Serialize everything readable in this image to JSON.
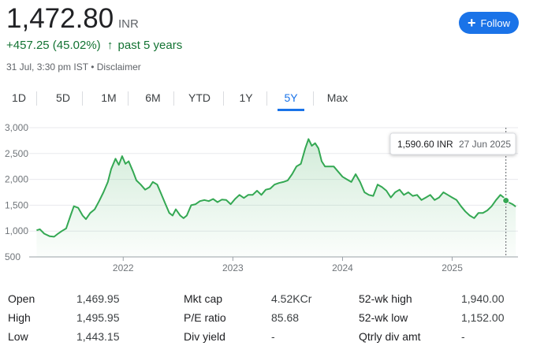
{
  "quote": {
    "price": "1,472.80",
    "currency": "INR",
    "change": "+457.25 (45.02%)",
    "change_arrow": "↑",
    "period": "past 5 years",
    "timestamp": "31 Jul, 3:30 pm IST",
    "separator": "•",
    "disclaimer": "Disclaimer",
    "follow_label": "Follow"
  },
  "tabs": [
    {
      "label": "1D",
      "active": false
    },
    {
      "label": "5D",
      "active": false
    },
    {
      "label": "1M",
      "active": false
    },
    {
      "label": "6M",
      "active": false
    },
    {
      "label": "YTD",
      "active": false
    },
    {
      "label": "1Y",
      "active": false
    },
    {
      "label": "5Y",
      "active": true
    },
    {
      "label": "Max",
      "active": false
    }
  ],
  "tooltip": {
    "value": "1,590.60 INR",
    "date": "27 Jun 2025"
  },
  "stats": [
    [
      {
        "label": "Open",
        "value": "1,469.95"
      },
      {
        "label": "Mkt cap",
        "value": "4.52KCr"
      },
      {
        "label": "52-wk high",
        "value": "1,940.00"
      }
    ],
    [
      {
        "label": "High",
        "value": "1,495.95"
      },
      {
        "label": "P/E ratio",
        "value": "85.68"
      },
      {
        "label": "52-wk low",
        "value": "1,152.00"
      }
    ],
    [
      {
        "label": "Low",
        "value": "1,443.15"
      },
      {
        "label": "Div yield",
        "value": "-"
      },
      {
        "label": "Qtrly div amt",
        "value": "-"
      }
    ]
  ],
  "colors": {
    "line": "#34a853",
    "accent": "#1a73e8",
    "positive": "#137333",
    "grid": "#e8eaed"
  },
  "chart_data": {
    "type": "area",
    "title": "",
    "xlabel": "",
    "ylabel": "",
    "ylim": [
      500,
      3000
    ],
    "xlim": [
      2021.2,
      2025.6
    ],
    "y_ticks": [
      500,
      1000,
      1500,
      2000,
      2500,
      3000
    ],
    "y_tick_labels": [
      "500",
      "1,000",
      "1,500",
      "2,000",
      "2,500",
      "3,000"
    ],
    "x_ticks": [
      2022,
      2023,
      2024,
      2025
    ],
    "x_tick_labels": [
      "2022",
      "2023",
      "2024",
      "2025"
    ],
    "grid": true,
    "highlight": {
      "x": 2025.49,
      "y": 1590.6
    },
    "series": [
      {
        "points": [
          [
            2021.21,
            1015
          ],
          [
            2021.24,
            1035
          ],
          [
            2021.28,
            950
          ],
          [
            2021.33,
            900
          ],
          [
            2021.37,
            890
          ],
          [
            2021.4,
            940
          ],
          [
            2021.44,
            1000
          ],
          [
            2021.48,
            1050
          ],
          [
            2021.52,
            1300
          ],
          [
            2021.55,
            1480
          ],
          [
            2021.59,
            1450
          ],
          [
            2021.63,
            1300
          ],
          [
            2021.66,
            1230
          ],
          [
            2021.7,
            1350
          ],
          [
            2021.74,
            1420
          ],
          [
            2021.78,
            1580
          ],
          [
            2021.82,
            1750
          ],
          [
            2021.86,
            1950
          ],
          [
            2021.89,
            2200
          ],
          [
            2021.93,
            2400
          ],
          [
            2021.96,
            2280
          ],
          [
            2021.99,
            2450
          ],
          [
            2022.02,
            2300
          ],
          [
            2022.05,
            2350
          ],
          [
            2022.09,
            2150
          ],
          [
            2022.12,
            1980
          ],
          [
            2022.16,
            1900
          ],
          [
            2022.2,
            1800
          ],
          [
            2022.24,
            1850
          ],
          [
            2022.27,
            1950
          ],
          [
            2022.31,
            1900
          ],
          [
            2022.34,
            1750
          ],
          [
            2022.38,
            1550
          ],
          [
            2022.42,
            1350
          ],
          [
            2022.45,
            1300
          ],
          [
            2022.48,
            1420
          ],
          [
            2022.52,
            1300
          ],
          [
            2022.55,
            1250
          ],
          [
            2022.58,
            1300
          ],
          [
            2022.62,
            1500
          ],
          [
            2022.66,
            1520
          ],
          [
            2022.7,
            1580
          ],
          [
            2022.74,
            1600
          ],
          [
            2022.78,
            1580
          ],
          [
            2022.82,
            1620
          ],
          [
            2022.86,
            1560
          ],
          [
            2022.9,
            1610
          ],
          [
            2022.94,
            1600
          ],
          [
            2022.98,
            1520
          ],
          [
            2023.02,
            1620
          ],
          [
            2023.06,
            1700
          ],
          [
            2023.1,
            1640
          ],
          [
            2023.14,
            1700
          ],
          [
            2023.18,
            1700
          ],
          [
            2023.22,
            1780
          ],
          [
            2023.26,
            1700
          ],
          [
            2023.3,
            1800
          ],
          [
            2023.34,
            1820
          ],
          [
            2023.38,
            1900
          ],
          [
            2023.42,
            1930
          ],
          [
            2023.46,
            1950
          ],
          [
            2023.5,
            1980
          ],
          [
            2023.54,
            2100
          ],
          [
            2023.58,
            2250
          ],
          [
            2023.62,
            2300
          ],
          [
            2023.66,
            2600
          ],
          [
            2023.69,
            2780
          ],
          [
            2023.72,
            2650
          ],
          [
            2023.75,
            2700
          ],
          [
            2023.78,
            2600
          ],
          [
            2023.81,
            2350
          ],
          [
            2023.84,
            2250
          ],
          [
            2023.88,
            2250
          ],
          [
            2023.92,
            2250
          ],
          [
            2023.96,
            2150
          ],
          [
            2024.0,
            2050
          ],
          [
            2024.04,
            2000
          ],
          [
            2024.08,
            1950
          ],
          [
            2024.12,
            2100
          ],
          [
            2024.16,
            1950
          ],
          [
            2024.2,
            1750
          ],
          [
            2024.24,
            1700
          ],
          [
            2024.28,
            1680
          ],
          [
            2024.32,
            1900
          ],
          [
            2024.36,
            1850
          ],
          [
            2024.4,
            1780
          ],
          [
            2024.44,
            1650
          ],
          [
            2024.48,
            1750
          ],
          [
            2024.52,
            1800
          ],
          [
            2024.56,
            1700
          ],
          [
            2024.6,
            1750
          ],
          [
            2024.64,
            1680
          ],
          [
            2024.68,
            1700
          ],
          [
            2024.72,
            1600
          ],
          [
            2024.76,
            1650
          ],
          [
            2024.8,
            1700
          ],
          [
            2024.84,
            1600
          ],
          [
            2024.88,
            1650
          ],
          [
            2024.92,
            1750
          ],
          [
            2024.96,
            1700
          ],
          [
            2025.0,
            1650
          ],
          [
            2025.04,
            1600
          ],
          [
            2025.08,
            1480
          ],
          [
            2025.12,
            1380
          ],
          [
            2025.16,
            1300
          ],
          [
            2025.2,
            1250
          ],
          [
            2025.24,
            1350
          ],
          [
            2025.28,
            1350
          ],
          [
            2025.32,
            1400
          ],
          [
            2025.36,
            1480
          ],
          [
            2025.4,
            1600
          ],
          [
            2025.44,
            1700
          ],
          [
            2025.47,
            1650
          ],
          [
            2025.49,
            1590.6
          ],
          [
            2025.52,
            1550
          ],
          [
            2025.55,
            1520
          ],
          [
            2025.58,
            1472.8
          ]
        ]
      }
    ]
  }
}
